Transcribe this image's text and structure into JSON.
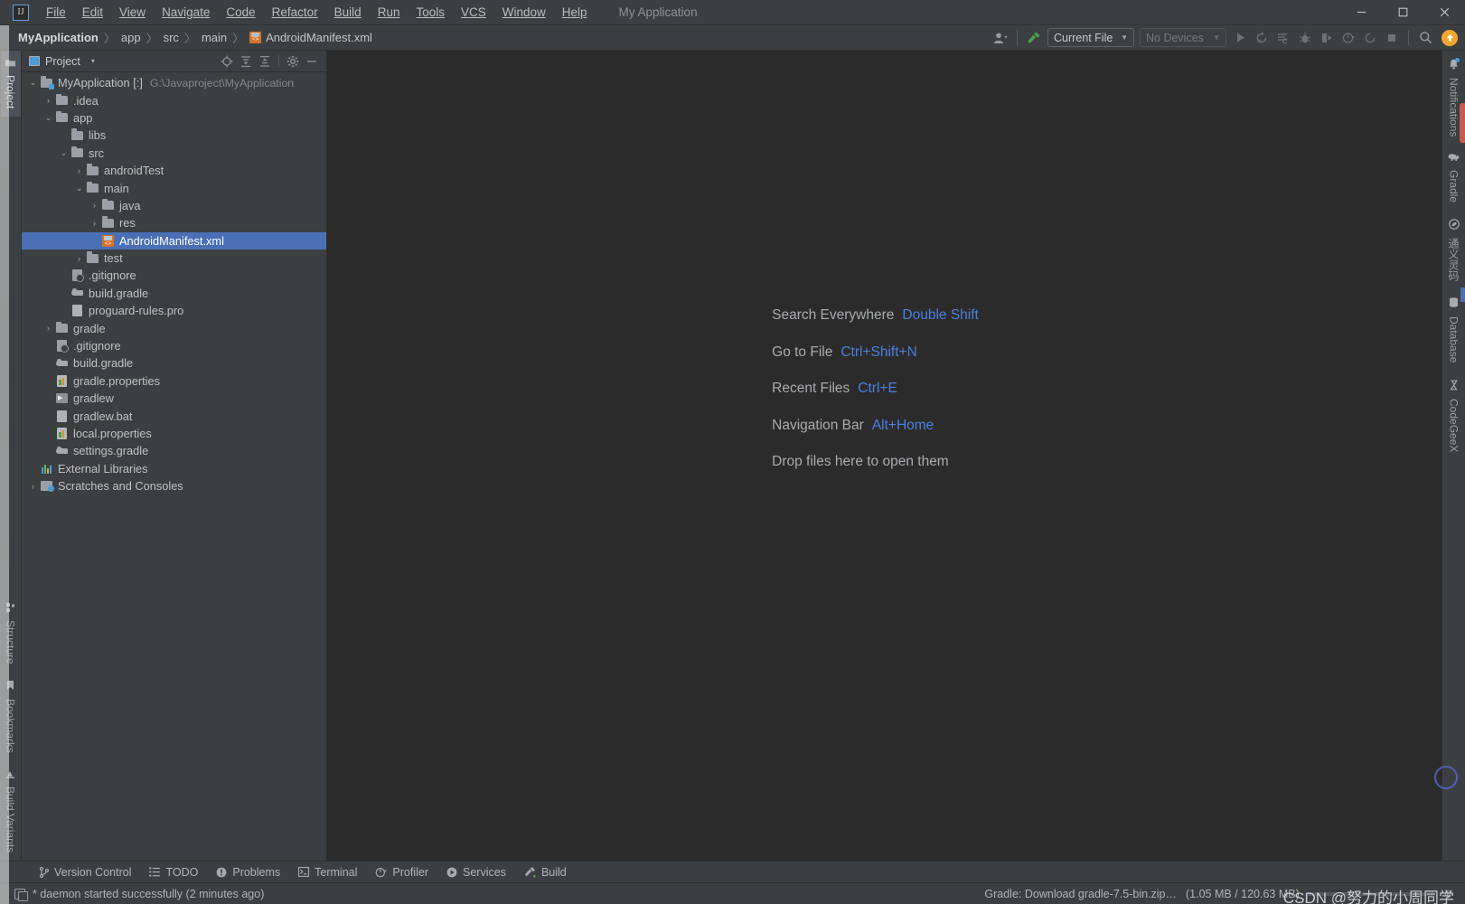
{
  "window": {
    "app_title": "My Application",
    "controls": {
      "minimize": "—",
      "maximize": "□",
      "close": "✕"
    }
  },
  "menu": {
    "items": [
      {
        "label": "File"
      },
      {
        "label": "Edit"
      },
      {
        "label": "View"
      },
      {
        "label": "Navigate"
      },
      {
        "label": "Code"
      },
      {
        "label": "Refactor"
      },
      {
        "label": "Build"
      },
      {
        "label": "Run"
      },
      {
        "label": "Tools"
      },
      {
        "label": "VCS"
      },
      {
        "label": "Window"
      },
      {
        "label": "Help"
      }
    ]
  },
  "breadcrumb": {
    "items": [
      {
        "label": "MyApplication",
        "bold": true
      },
      {
        "label": "app",
        "bold": false
      },
      {
        "label": "src",
        "bold": false
      },
      {
        "label": "main",
        "bold": false
      }
    ],
    "separator": "〉",
    "file": "AndroidManifest.xml"
  },
  "toolbar": {
    "run_config": "Current File",
    "device": "No Devices",
    "caret": "▼",
    "icons": [
      "user-avatar-icon",
      "build-hammer-icon",
      "run-icon",
      "rerun-icon",
      "run-with-coverage-icon",
      "debug-icon",
      "profile-icon",
      "attach-debugger-icon",
      "apply-changes-icon",
      "stop-icon",
      "search-icon",
      "update-available-icon"
    ],
    "update_glyph": "↑"
  },
  "left_tool_tabs": {
    "top": [
      {
        "label": "Project",
        "active": true,
        "icon": "folder-icon"
      }
    ],
    "bottom": [
      {
        "label": "Structure",
        "active": false,
        "icon": "structure-icon"
      },
      {
        "label": "Bookmarks",
        "active": false,
        "icon": "bookmark-icon"
      },
      {
        "label": "Build Variants",
        "active": false,
        "icon": "variants-icon"
      }
    ]
  },
  "right_tool_tabs": [
    {
      "label": "Notifications",
      "icon": "bell-icon",
      "badge": true
    },
    {
      "label": "Gradle",
      "icon": "gradle-elephant-icon",
      "badge": false
    },
    {
      "label": "通义灵码",
      "icon": "tongyi-icon",
      "badge": false
    },
    {
      "label": "Database",
      "icon": "database-icon",
      "badge": false
    },
    {
      "label": "CodeGeeX",
      "icon": "codegeex-icon",
      "badge": false
    }
  ],
  "project_panel": {
    "title": "Project",
    "title_caret": "▾",
    "actions": [
      {
        "name": "select-opened-file-icon",
        "glyph": "⌖"
      },
      {
        "name": "expand-all-icon",
        "glyph": "≡"
      },
      {
        "name": "collapse-all-icon",
        "glyph": "≡"
      },
      {
        "name": "settings-gear-icon",
        "glyph": "⚙"
      },
      {
        "name": "hide-panel-icon",
        "glyph": "—"
      }
    ],
    "tree": [
      {
        "depth": 0,
        "arrow": "⌄",
        "icon": "project-folder",
        "label": "MyApplication [:]",
        "path": "G:\\Javaproject\\MyApplication",
        "selected": false
      },
      {
        "depth": 1,
        "arrow": "›",
        "icon": "folder",
        "label": ".idea",
        "path": "",
        "selected": false
      },
      {
        "depth": 1,
        "arrow": "⌄",
        "icon": "folder",
        "label": "app",
        "path": "",
        "selected": false
      },
      {
        "depth": 2,
        "arrow": "",
        "icon": "folder",
        "label": "libs",
        "path": "",
        "selected": false
      },
      {
        "depth": 2,
        "arrow": "⌄",
        "icon": "folder",
        "label": "src",
        "path": "",
        "selected": false
      },
      {
        "depth": 3,
        "arrow": "›",
        "icon": "folder",
        "label": "androidTest",
        "path": "",
        "selected": false
      },
      {
        "depth": 3,
        "arrow": "⌄",
        "icon": "folder",
        "label": "main",
        "path": "",
        "selected": false
      },
      {
        "depth": 4,
        "arrow": "›",
        "icon": "folder",
        "label": "java",
        "path": "",
        "selected": false
      },
      {
        "depth": 4,
        "arrow": "›",
        "icon": "folder",
        "label": "res",
        "path": "",
        "selected": false
      },
      {
        "depth": 4,
        "arrow": "",
        "icon": "manifest",
        "label": "AndroidManifest.xml",
        "path": "",
        "selected": true
      },
      {
        "depth": 3,
        "arrow": "›",
        "icon": "folder",
        "label": "test",
        "path": "",
        "selected": false
      },
      {
        "depth": 2,
        "arrow": "",
        "icon": "gitignore",
        "label": ".gitignore",
        "path": "",
        "selected": false
      },
      {
        "depth": 2,
        "arrow": "",
        "icon": "gradle",
        "label": "build.gradle",
        "path": "",
        "selected": false
      },
      {
        "depth": 2,
        "arrow": "",
        "icon": "file",
        "label": "proguard-rules.pro",
        "path": "",
        "selected": false
      },
      {
        "depth": 1,
        "arrow": "›",
        "icon": "folder",
        "label": "gradle",
        "path": "",
        "selected": false
      },
      {
        "depth": 1,
        "arrow": "",
        "icon": "gitignore",
        "label": ".gitignore",
        "path": "",
        "selected": false
      },
      {
        "depth": 1,
        "arrow": "",
        "icon": "gradle",
        "label": "build.gradle",
        "path": "",
        "selected": false
      },
      {
        "depth": 1,
        "arrow": "",
        "icon": "properties",
        "label": "gradle.properties",
        "path": "",
        "selected": false
      },
      {
        "depth": 1,
        "arrow": "",
        "icon": "shell",
        "label": "gradlew",
        "path": "",
        "selected": false
      },
      {
        "depth": 1,
        "arrow": "",
        "icon": "file",
        "label": "gradlew.bat",
        "path": "",
        "selected": false
      },
      {
        "depth": 1,
        "arrow": "",
        "icon": "properties",
        "label": "local.properties",
        "path": "",
        "selected": false
      },
      {
        "depth": 1,
        "arrow": "",
        "icon": "gradle",
        "label": "settings.gradle",
        "path": "",
        "selected": false
      },
      {
        "depth": 0,
        "arrow": "",
        "icon": "libraries",
        "label": "External Libraries",
        "path": "",
        "selected": false
      },
      {
        "depth": 0,
        "arrow": "›",
        "icon": "scratches",
        "label": "Scratches and Consoles",
        "path": "",
        "selected": false
      }
    ]
  },
  "editor_hints": [
    {
      "label": "Search Everywhere",
      "key": "Double Shift"
    },
    {
      "label": "Go to File",
      "key": "Ctrl+Shift+N"
    },
    {
      "label": "Recent Files",
      "key": "Ctrl+E"
    },
    {
      "label": "Navigation Bar",
      "key": "Alt+Home"
    },
    {
      "label": "Drop files here to open them",
      "key": ""
    }
  ],
  "bottom_tool_windows": [
    {
      "label": "Version Control",
      "icon": "branch-icon"
    },
    {
      "label": "TODO",
      "icon": "list-icon"
    },
    {
      "label": "Problems",
      "icon": "warning-icon"
    },
    {
      "label": "Terminal",
      "icon": "terminal-icon"
    },
    {
      "label": "Profiler",
      "icon": "profiler-icon"
    },
    {
      "label": "Services",
      "icon": "services-icon"
    },
    {
      "label": "Build",
      "icon": "hammer-icon"
    }
  ],
  "statusbar": {
    "message": "* daemon started successfully (2 minutes ago)",
    "task": "Gradle: Download gradle-7.5-bin.zip…",
    "task_progress_text": "(1.05 MB / 120.63 MB)",
    "progress_percent": 1,
    "cancel_glyph": "⊗",
    "watermark": "CSDN @努力的小周同学"
  },
  "colors": {
    "panel_bg": "#3c3f41",
    "editor_bg": "#2b2b2b",
    "selection_blue": "#4a6fb5",
    "hint_key_blue": "#4b7fe0",
    "accent_orange": "#f0a732",
    "manifest_orange": "#d4722c",
    "build_green": "#4f9e4f"
  }
}
